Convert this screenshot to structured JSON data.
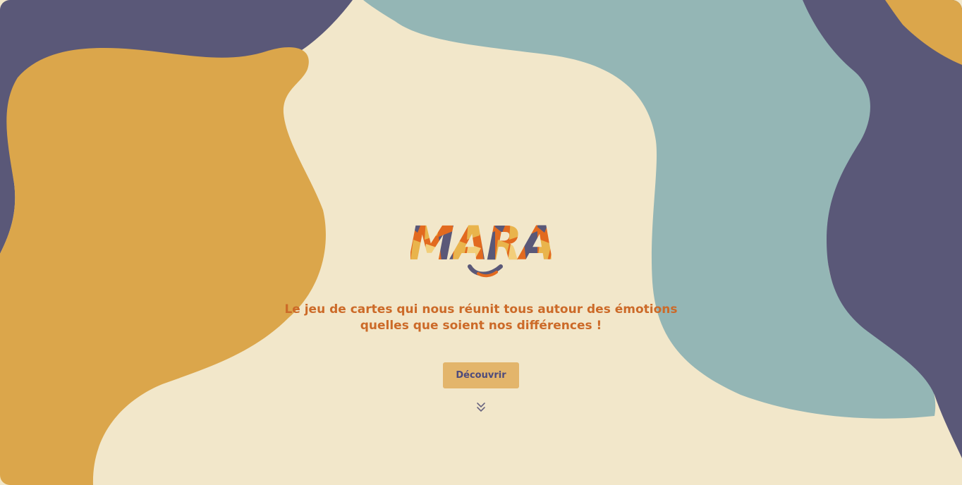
{
  "logo": {
    "text": "MARA"
  },
  "hero": {
    "tagline_line1": "Le jeu de cartes qui nous réunit tous autour des émotions",
    "tagline_line2": "quelles que soient nos différences !",
    "cta_label": "Découvrir"
  },
  "icons": {
    "scroll": "chevron-double-down-icon"
  },
  "colors": {
    "background": "#F2E7CA",
    "purple": "#5A5878",
    "mustard": "#DBA64B",
    "teal": "#94B6B5",
    "orange": "#E26A1F",
    "tagline": "#CC6A28",
    "button": "#E3B56B",
    "button_text": "#4D4A7C"
  }
}
